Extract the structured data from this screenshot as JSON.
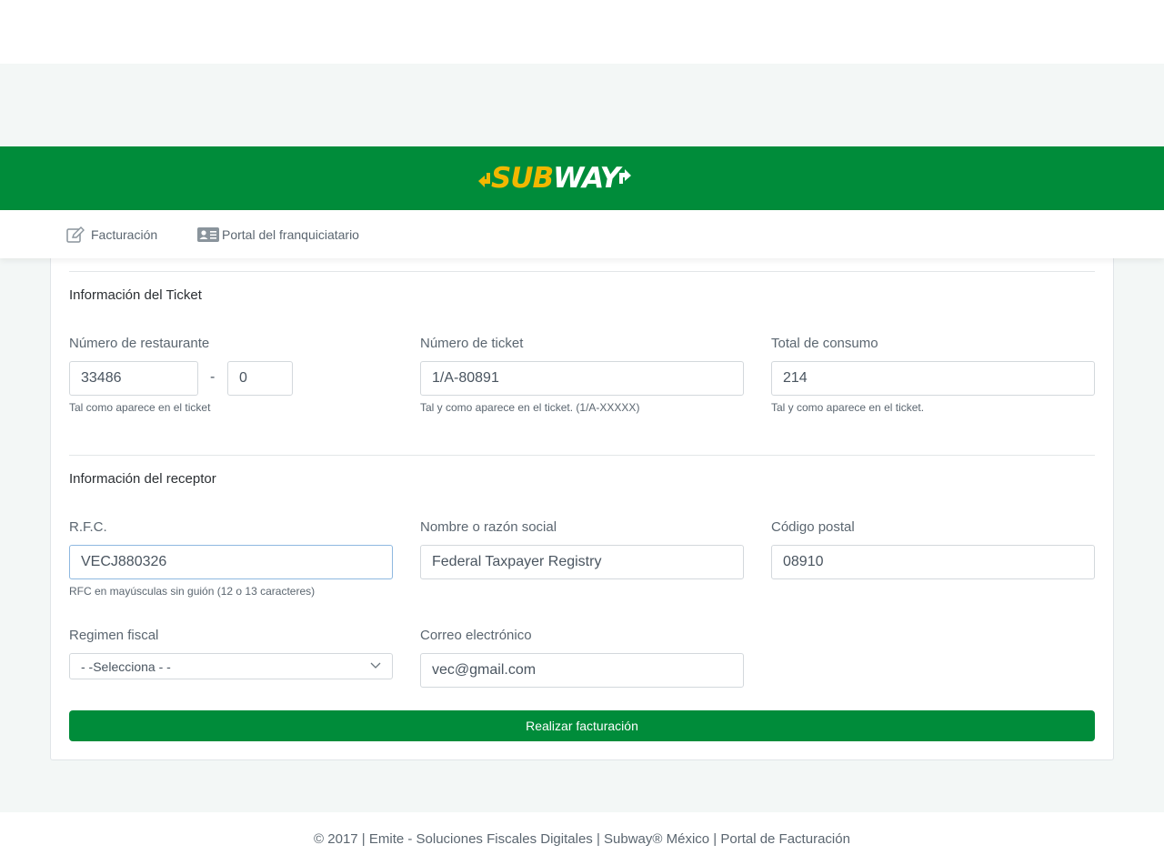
{
  "brand": {
    "logo_part1": "SUB",
    "logo_part2": "WAY",
    "brand_green": "#008c3a",
    "brand_yellow": "#f2b700"
  },
  "nav": {
    "items": [
      {
        "label": "Facturación",
        "icon": "edit-icon"
      },
      {
        "label": "Portal del franquiciatario",
        "icon": "id-card-icon"
      }
    ]
  },
  "ticket": {
    "title": "Información del Ticket",
    "restaurant": {
      "label": "Número de restaurante",
      "value": "33486",
      "separator": "-",
      "suffix_value": "0",
      "help": "Tal como aparece en el ticket"
    },
    "ticket_number": {
      "label": "Número de ticket",
      "value": "1/A-80891",
      "help": "Tal y como aparece en el ticket. (1/A-XXXXX)"
    },
    "total": {
      "label": "Total de consumo",
      "value": "214",
      "help": "Tal y como aparece en el ticket."
    }
  },
  "receptor": {
    "title": "Información del receptor",
    "rfc": {
      "label": "R.F.C.",
      "value": "VECJ880326",
      "help": "RFC en mayúsculas sin guión (12 o 13 caracteres)"
    },
    "name": {
      "label": "Nombre o razón social",
      "value": "Federal Taxpayer Registry"
    },
    "postal_code": {
      "label": "Código postal",
      "value": "08910"
    },
    "regime": {
      "label": "Regimen fiscal",
      "selected": "- -Selecciona - -"
    },
    "email": {
      "label": "Correo electrónico",
      "value": "vec@gmail.com"
    }
  },
  "submit_label": "Realizar facturación",
  "footer": {
    "text": "© 2017 | Emite - Soluciones Fiscales Digitales | Subway® México | Portal de Facturación"
  }
}
